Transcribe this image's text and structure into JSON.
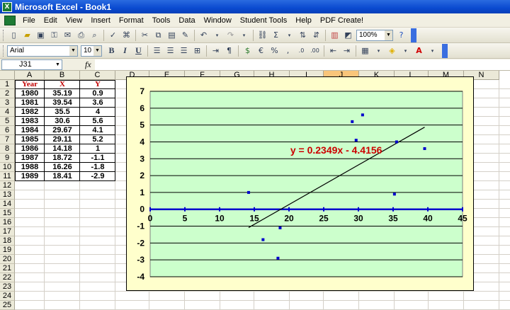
{
  "window": {
    "title": "Microsoft Excel - Book1",
    "app_icon_letter": "X"
  },
  "menu": [
    "File",
    "Edit",
    "View",
    "Insert",
    "Format",
    "Tools",
    "Data",
    "Window",
    "Student Tools",
    "Help",
    "PDF Create!"
  ],
  "toolbar1": {
    "zoom": "100%"
  },
  "toolbar2": {
    "font": "Arial",
    "size": "10",
    "bold": "B",
    "italic": "I",
    "underline": "U",
    "currency": "%"
  },
  "formula_bar": {
    "name_box": "J31",
    "fx_label": "fx",
    "value": ""
  },
  "columns": [
    "A",
    "B",
    "C",
    "D",
    "E",
    "F",
    "G",
    "H",
    "I",
    "J",
    "K",
    "L",
    "M",
    "N"
  ],
  "selected_column": "J",
  "rows": [
    "1",
    "2",
    "3",
    "4",
    "5",
    "6",
    "7",
    "8",
    "9",
    "10",
    "11",
    "12",
    "13",
    "14",
    "15",
    "16",
    "17",
    "18",
    "19",
    "20",
    "21",
    "22",
    "23",
    "24",
    "25"
  ],
  "table": {
    "headers": [
      "Year",
      "X",
      "Y"
    ],
    "rows": [
      [
        "1980",
        "35.19",
        "0.9"
      ],
      [
        "1981",
        "39.54",
        "3.6"
      ],
      [
        "1982",
        "35.5",
        "4"
      ],
      [
        "1983",
        "30.6",
        "5.6"
      ],
      [
        "1984",
        "29.67",
        "4.1"
      ],
      [
        "1985",
        "29.11",
        "5.2"
      ],
      [
        "1986",
        "14.18",
        "1"
      ],
      [
        "1987",
        "18.72",
        "-1.1"
      ],
      [
        "1988",
        "16.26",
        "-1.8"
      ],
      [
        "1989",
        "18.41",
        "-2.9"
      ]
    ]
  },
  "colors": {
    "plot_bg": "#ccffcc",
    "chart_bg": "#ffffcc",
    "axis": "#0000cc",
    "equation": "#cc0000"
  },
  "chart_data": {
    "type": "scatter",
    "x": [
      35.19,
      39.54,
      35.5,
      30.6,
      29.67,
      29.11,
      14.18,
      18.72,
      16.26,
      18.41
    ],
    "y": [
      0.9,
      3.6,
      4,
      5.6,
      4.1,
      5.2,
      1,
      -1.1,
      -1.8,
      -2.9
    ],
    "xlim": [
      0,
      45
    ],
    "ylim": [
      -4,
      7
    ],
    "xticks": [
      "0",
      "5",
      "10",
      "15",
      "20",
      "25",
      "30",
      "35",
      "40",
      "45"
    ],
    "yticks": [
      "7",
      "6",
      "5",
      "4",
      "3",
      "2",
      "1",
      "0",
      "-1",
      "-2",
      "-3",
      "-4"
    ],
    "grid": "horizontal",
    "trendline": {
      "type": "linear",
      "slope": 0.2349,
      "intercept": -4.4156,
      "x_from": 14.18,
      "x_to": 39.54
    },
    "annotation": "y = 0.2349x - 4.4156"
  }
}
